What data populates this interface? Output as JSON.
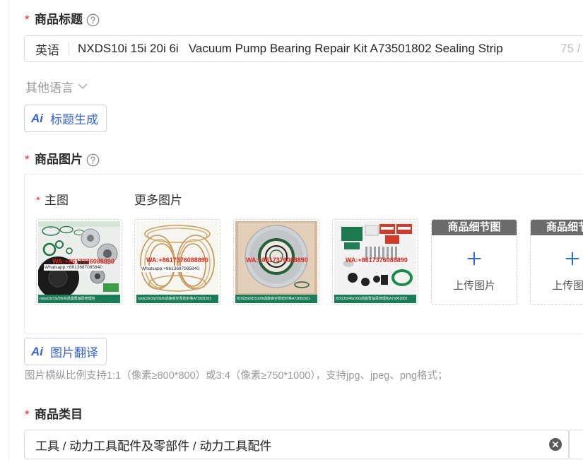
{
  "form": {
    "title_field": {
      "required_mark": "*",
      "label": "商品标题",
      "help_icon": "question-circle-icon",
      "language_tag": "英语",
      "value": "NXDS10i 15i 20i 6i   Vacuum Pump Bearing Repair Kit A73501802 Sealing Strip",
      "char_counter": "75 /"
    },
    "other_languages": {
      "label": "其他语言",
      "icon": "chevron-down-icon"
    },
    "ai_title_button": {
      "icon_text": "Ai",
      "label": "标题生成"
    },
    "images_field": {
      "required_mark": "*",
      "label": "商品图片",
      "help_icon": "question-circle-icon",
      "main_image": {
        "required_mark": "*",
        "label": "主图"
      },
      "more_images_label": "更多图片",
      "images": [
        {
          "watermark": "WA:+8617376088890",
          "contact": "Whatsapp:+8613687085840",
          "caption": "nxds10i/15i/20i/6i涡旋泵轴承修理包"
        },
        {
          "watermark": "WA:+8617376088890",
          "contact": "Whatsapp:+8613687085840.",
          "caption": "nxds10i/15i/20i/6i涡旋真空泵密封条A73501501"
        },
        {
          "watermark": "WA:+8617376088890",
          "caption": "XDS35i/XDS100i涡旋真空泵密封条A73001501"
        },
        {
          "watermark": "WA:+8617376088890",
          "caption": "XDS35i/46i/100i涡旋泵轴承修理包A73001802"
        }
      ],
      "upload_slots": [
        {
          "header": "商品细节图",
          "label": "上传图片",
          "icon": "plus-icon"
        },
        {
          "header": "商品细节图",
          "label": "上传图片",
          "icon": "plus-icon"
        }
      ]
    },
    "ai_image_button": {
      "icon_text": "Ai",
      "label": "图片翻译"
    },
    "image_hint": "图片横纵比例支持1:1（像素≥800*800）或3:4（像素≥750*1000），支持jpg、jpeg、png格式；",
    "category_field": {
      "required_mark": "*",
      "label": "商品类目",
      "value": "工具 / 动力工具配件及零部件 / 动力工具配件",
      "clear_icon": "close-circle-icon"
    }
  },
  "colors": {
    "accent": "#3461d9",
    "required": "#f5222d",
    "upload_header": "#6b6b6b",
    "image_band": "#1b7d58"
  }
}
